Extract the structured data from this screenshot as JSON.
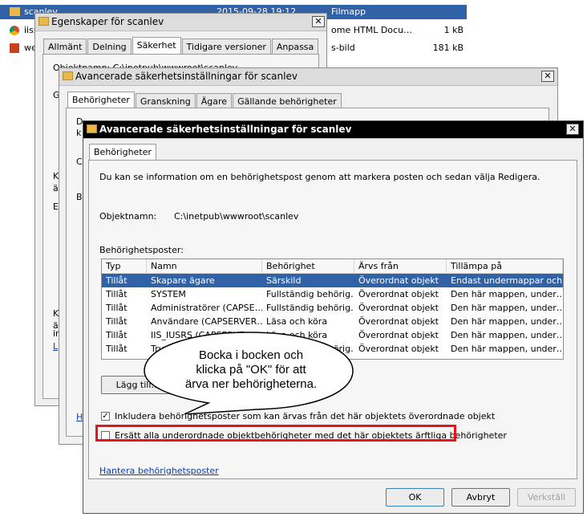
{
  "explorer": {
    "rows": [
      {
        "name": "scanlev",
        "date": "2015-09-28 19:12",
        "type": "Filmapp",
        "size": ""
      },
      {
        "name": "iiss",
        "type": "ome HTML Docu…",
        "size": "1 kB"
      },
      {
        "name": "we",
        "type": "s-bild",
        "size": "181 kB"
      }
    ]
  },
  "props_window": {
    "title": "Egenskaper för scanlev",
    "tabs": [
      "Allmänt",
      "Delning",
      "Säkerhet",
      "Tidigare versioner",
      "Anpassa"
    ],
    "fragments": [
      "Objektnamn:  C:\\inetpub\\wwwroot\\scanlev",
      "G",
      "K",
      "ä",
      "E",
      "K",
      "ä",
      "ir",
      "L"
    ]
  },
  "adv_back": {
    "title": "Avancerade säkerhetsinställningar för scanlev",
    "tabs": [
      "Behörigheter",
      "Granskning",
      "Ägare",
      "Gällande behörigheter"
    ],
    "fragments": [
      "D",
      "k",
      "C",
      "B",
      "Hantera",
      "L"
    ]
  },
  "adv_front": {
    "title": "Avancerade säkerhetsinställningar för scanlev",
    "tab": "Behörigheter",
    "description": "Du kan se information om en behörighetspost genom att markera posten och sedan välja Redigera.",
    "object_label": "Objektnamn:",
    "object_path": "C:\\inetpub\\wwwroot\\scanlev",
    "entries_label": "Behörighetsposter:",
    "columns": [
      "Typ",
      "Namn",
      "Behörighet",
      "Ärvs från",
      "Tillämpa på"
    ],
    "rows": [
      [
        "Tillåt",
        "Skapare ägare",
        "Särskild",
        "Överordnat objekt",
        "Endast undermappar och…"
      ],
      [
        "Tillåt",
        "SYSTEM",
        "Fullständig behörig…",
        "Överordnat objekt",
        "Den här mappen, under…"
      ],
      [
        "Tillåt",
        "Administratörer (CAPSE…",
        "Fullständig behörig…",
        "Överordnat objekt",
        "Den här mappen, under…"
      ],
      [
        "Tillåt",
        "Användare (CAPSERVER…",
        "Läsa och köra",
        "Överordnat objekt",
        "Den här mappen, under…"
      ],
      [
        "Tillåt",
        "IIS_IUSRS (CAPSERVE…",
        "Läsa och köra",
        "Överordnat objekt",
        "Den här mappen, under…"
      ],
      [
        "Tillåt",
        "Trust…",
        "Fullständig behörig…",
        "Överordnat objekt",
        "Den här mappen, under…"
      ]
    ],
    "add_button": "Lägg till…",
    "inherit_checkbox": "Inkludera behörighetsposter som kan ärvas från det här objektets överordnade objekt",
    "inherit_checked": true,
    "replace_checkbox": "Ersätt alla underordnade objektbehörigheter med det här objektets ärftliga behörigheter",
    "replace_checked": false,
    "manage_link": "Hantera behörighetsposter",
    "ok": "OK",
    "cancel": "Avbryt",
    "apply": "Verkställ"
  },
  "callout": {
    "text": "Bocka i bocken och klicka på \"OK\" för att ärva ner behörigheterna."
  },
  "colors": {
    "highlight_border": "#e8141c",
    "selection": "#3162a8",
    "link": "#0a3ea8"
  }
}
